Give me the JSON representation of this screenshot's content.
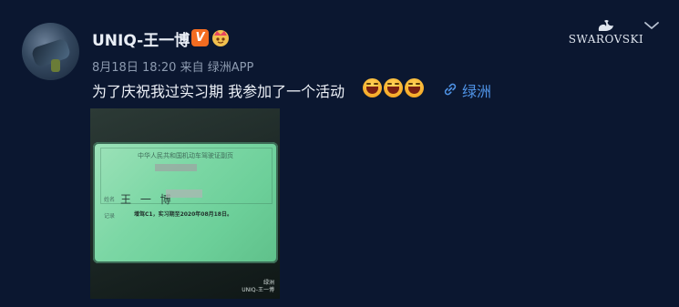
{
  "post": {
    "username": "UNIQ-王一博",
    "verified_badge": "V",
    "meta": {
      "date": "8月18日",
      "time": "18:20",
      "source_prefix": "来自",
      "source": "绿洲APP"
    },
    "text": "为了庆祝我过实习期 我参加了一个活动",
    "emojis": [
      "grinning-face-emoji",
      "grinning-face-emoji",
      "grinning-face-emoji"
    ],
    "location": "绿洲"
  },
  "brand": {
    "name": "SWAROVSKI"
  },
  "photo": {
    "card_title": "中华人民共和国机动车驾驶证副页",
    "name_label": "姓名",
    "name_value": "王 一 博",
    "record_label": "记录",
    "note": "增驾C1，实习期至2020年08月18日。",
    "watermark_app": "绿洲",
    "watermark_user": "UNIQ-王一博"
  },
  "colors": {
    "background": "#0b1730",
    "link": "#4f93e6",
    "meta": "#8d9bb0",
    "verified": "#f36c21"
  }
}
